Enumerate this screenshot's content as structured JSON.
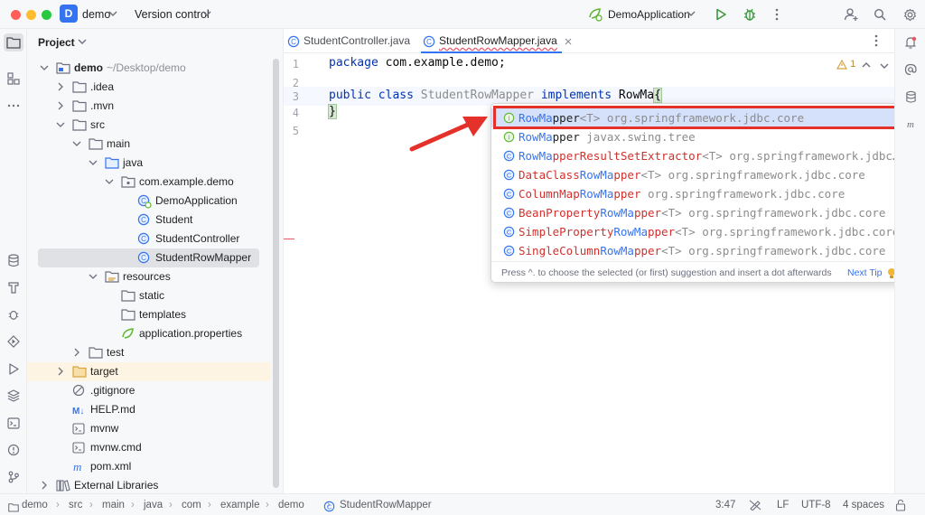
{
  "titlebar": {
    "project_badge": "D",
    "project_name": "demo",
    "vcs": "Version control",
    "run_config": "DemoApplication"
  },
  "project_panel": {
    "title": "Project",
    "tree": [
      {
        "label": "demo",
        "suffix": "~/Desktop/demo"
      },
      {
        "label": ".idea"
      },
      {
        "label": ".mvn"
      },
      {
        "label": "src"
      },
      {
        "label": "main"
      },
      {
        "label": "java"
      },
      {
        "label": "com.example.demo"
      },
      {
        "label": "DemoApplication"
      },
      {
        "label": "Student"
      },
      {
        "label": "StudentController"
      },
      {
        "label": "StudentRowMapper"
      },
      {
        "label": "resources"
      },
      {
        "label": "static"
      },
      {
        "label": "templates"
      },
      {
        "label": "application.properties"
      },
      {
        "label": "test"
      },
      {
        "label": "target"
      },
      {
        "label": ".gitignore"
      },
      {
        "label": "HELP.md",
        "badge": "M↓"
      },
      {
        "label": "mvnw"
      },
      {
        "label": "mvnw.cmd"
      },
      {
        "label": "pom.xml",
        "badge": "m"
      },
      {
        "label": "External Libraries"
      }
    ]
  },
  "editor": {
    "tabs": [
      {
        "label": "StudentController.java",
        "active": false
      },
      {
        "label": "StudentRowMapper.java",
        "active": true
      }
    ],
    "line_numbers": [
      "1",
      "2",
      "3",
      "4",
      "5"
    ],
    "lines": {
      "l1_kw": "package",
      "l1_rest": " com.example.demo;",
      "l3_kw1": "public class",
      "l3_name": " StudentRowMapper ",
      "l3_kw2": "implements",
      "l3_typed": " RowMa",
      "l3_brace": "{",
      "l4": "}"
    },
    "warning_count": "1"
  },
  "completion": {
    "items": [
      {
        "icon": "I",
        "match": "RowMa",
        "rest": "pper",
        "generic": "<T>",
        "pkg": " org.springframework.jdbc.core",
        "selected": true
      },
      {
        "icon": "I",
        "match": "RowMa",
        "rest": "pper",
        "generic": "",
        "pkg": " javax.swing.tree"
      },
      {
        "icon": "C",
        "match": "RowMa",
        "rest": "pperResultSetExtractor",
        "generic": "<T>",
        "pkg": " org.springframework.jdbc…"
      },
      {
        "icon": "C",
        "pre": "DataClass",
        "match": "RowMa",
        "rest": "pper",
        "generic": "<T>",
        "pkg": " org.springframework.jdbc.core"
      },
      {
        "icon": "C",
        "pre": "ColumnMap",
        "match": "RowMa",
        "rest": "pper",
        "generic": "",
        "pkg": " org.springframework.jdbc.core"
      },
      {
        "icon": "C",
        "pre": "BeanProperty",
        "match": "RowMa",
        "rest": "pper",
        "generic": "<T>",
        "pkg": " org.springframework.jdbc.core"
      },
      {
        "icon": "C",
        "pre": "SimpleProperty",
        "match": "RowMa",
        "rest": "pper",
        "generic": "<T>",
        "pkg": " org.springframework.jdbc.core"
      },
      {
        "icon": "C",
        "pre": "SingleColumn",
        "match": "RowMa",
        "rest": "pper",
        "generic": "<T>",
        "pkg": " org.springframework.jdbc.core"
      }
    ],
    "footer_text": "Press ^. to choose the selected (or first) suggestion and insert a dot afterwards",
    "next_tip": "Next Tip"
  },
  "statusbar": {
    "breadcrumb": [
      "demo",
      "src",
      "main",
      "java",
      "com",
      "example",
      "demo",
      "StudentRowMapper"
    ],
    "position": "3:47",
    "line_sep": "LF",
    "encoding": "UTF-8",
    "indent": "4 spaces"
  },
  "colors": {
    "accent": "#3574f0",
    "highlight_border": "#e4322b",
    "match_text": "#3574f0",
    "class_name_red": "#d0312d"
  }
}
